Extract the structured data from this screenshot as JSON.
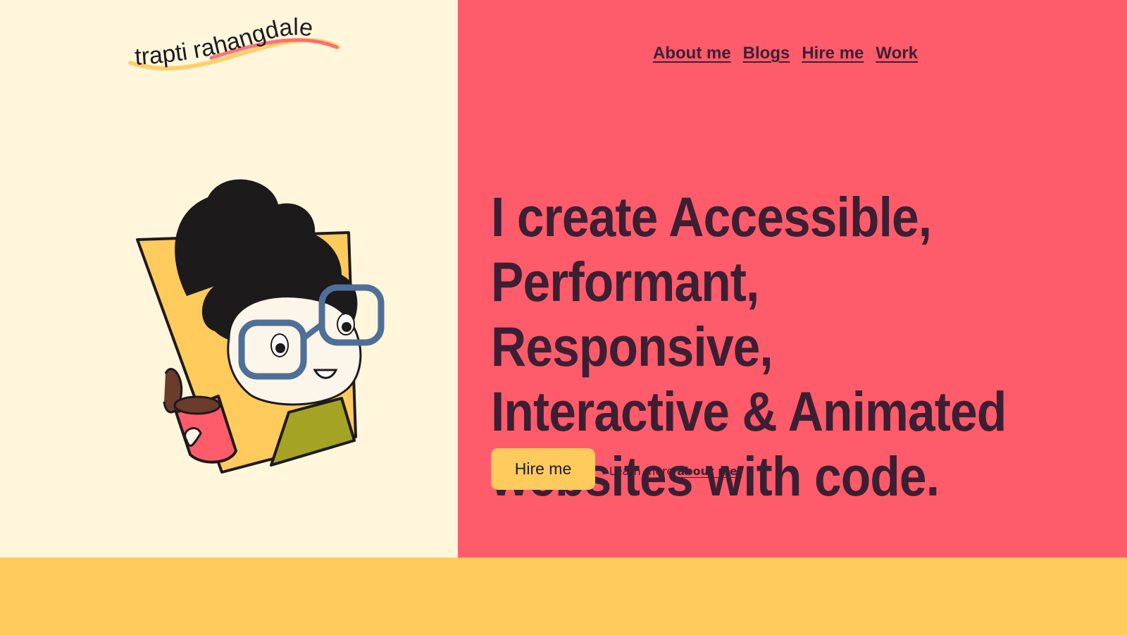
{
  "brand": {
    "logo_text": "trapti rahangdale"
  },
  "nav": {
    "items": [
      {
        "label": "About me"
      },
      {
        "label": "Blogs"
      },
      {
        "label": "Hire me"
      },
      {
        "label": "Work"
      }
    ]
  },
  "hero": {
    "headline_lines": [
      "I create Accessible,",
      "Performant, Responsive,",
      "Interactive & Animated",
      "websites with code."
    ],
    "cta_button": "Hire me",
    "learn_more_prefix": "Learn more ",
    "learn_more_link": "about me."
  },
  "colors": {
    "left_background": "#fff6dc",
    "right_background": "#ff5c6b",
    "band_background": "#ffcb5c",
    "text_dark": "#3d1f33",
    "button_background": "#ffcb5c"
  },
  "icons": {
    "illustration": "avatar-girl-with-coffee-illustration"
  }
}
